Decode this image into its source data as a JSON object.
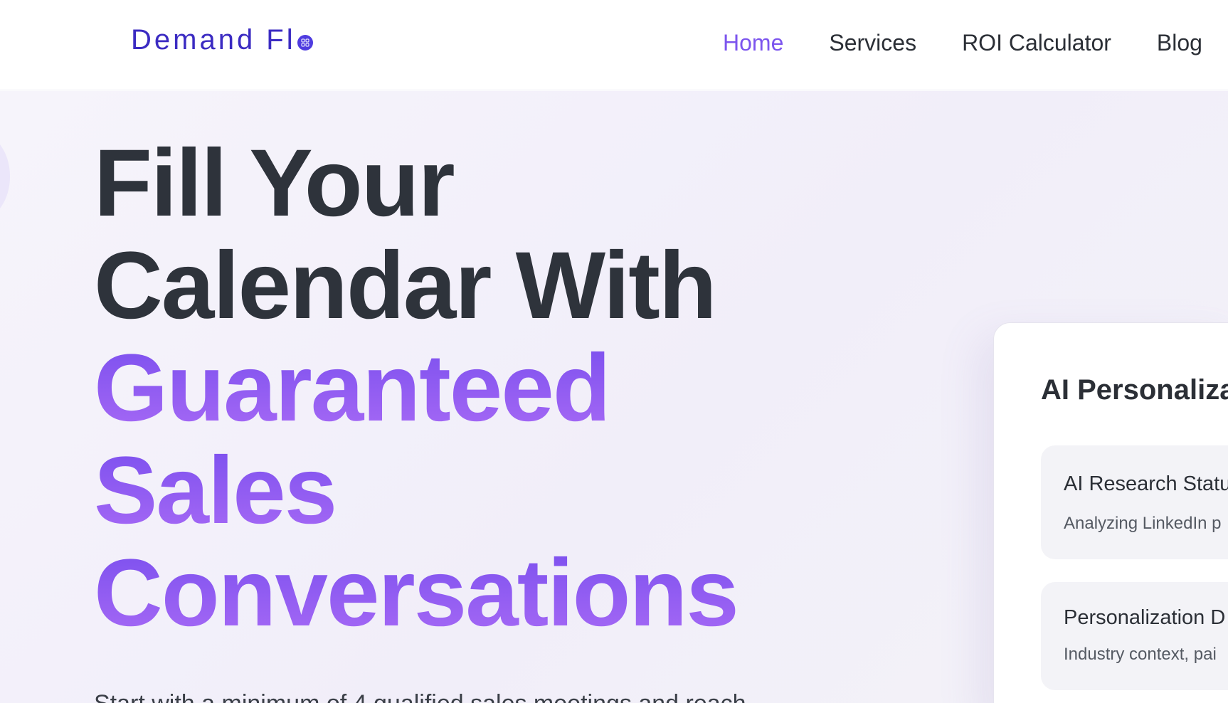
{
  "header": {
    "logo_text": "Demand Fl",
    "nav": [
      {
        "label": "Home",
        "active": true
      },
      {
        "label": "Services",
        "active": false
      },
      {
        "label": "ROI Calculator",
        "active": false
      },
      {
        "label": "Blog",
        "active": false
      }
    ]
  },
  "hero": {
    "headline_line1": "Fill Your",
    "headline_line2": "Calendar With",
    "headline_accent1": "Guaranteed",
    "headline_accent2": "Sales",
    "headline_accent3": "Conversations",
    "subheadline_partial": "Start with a minimum of 4 qualified sales meetings and reach"
  },
  "card": {
    "title": "AI Personaliza",
    "status_title": "AI Research Statu",
    "status_desc": "Analyzing LinkedIn p",
    "personalization_title": "Personalization D",
    "personalization_desc": "Industry context, pai"
  },
  "colors": {
    "brand": "#3b2bc2",
    "accent": "#7c55ee",
    "text_dark": "#2e333b"
  }
}
